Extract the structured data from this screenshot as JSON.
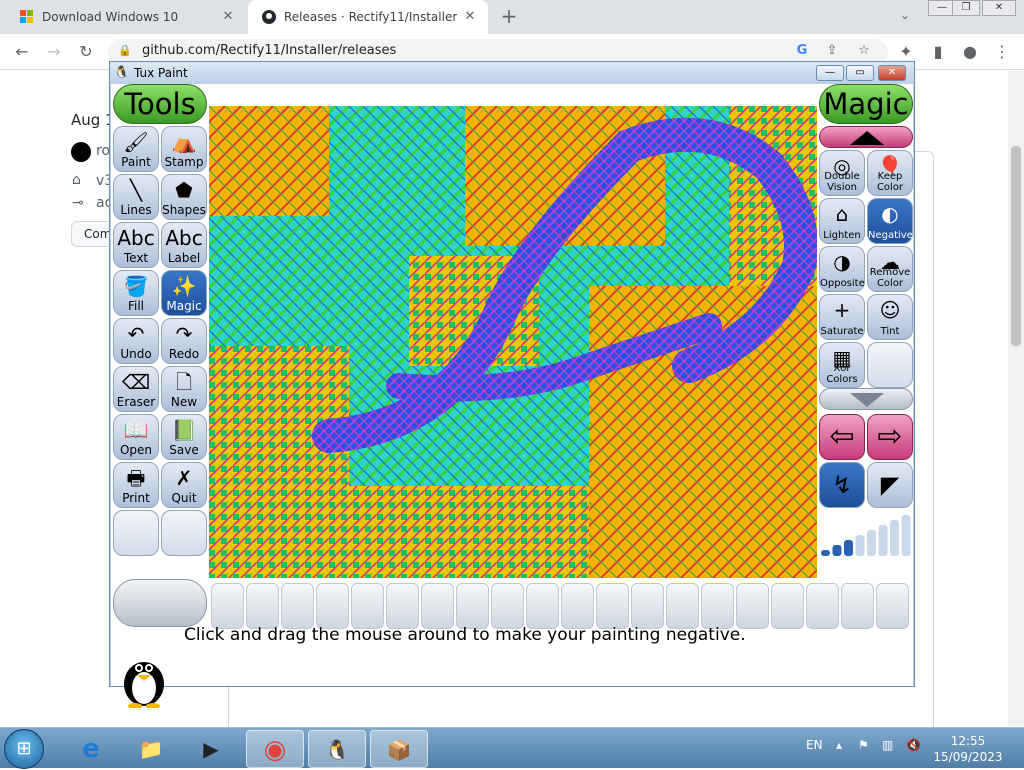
{
  "browser": {
    "tabs": [
      {
        "label": "Download Windows 10",
        "active": false,
        "icon": "windows-logo-icon"
      },
      {
        "label": "Releases · Rectify11/Installer",
        "active": true,
        "icon": "github-icon"
      }
    ],
    "url": "github.com/Rectify11/Installer/releases",
    "window_controls": {
      "minimize": "—",
      "restore": "❐",
      "close": "✕"
    }
  },
  "github_page": {
    "date_fragment": "Aug 1",
    "user_fragment": "ro",
    "tag_fragment": "v3",
    "commit_fragment": "ac",
    "compare_fragment": "Com"
  },
  "tuxpaint": {
    "title": "Tux Paint",
    "tools_header": "Tools",
    "magic_header": "Magic",
    "tools": [
      {
        "label": "Paint",
        "icon": "paintbrush-icon",
        "glyph": "🖌"
      },
      {
        "label": "Stamp",
        "icon": "stamp-icon",
        "glyph": "⛺"
      },
      {
        "label": "Lines",
        "icon": "lines-icon",
        "glyph": "╲"
      },
      {
        "label": "Shapes",
        "icon": "pentagon-icon",
        "glyph": "⬟"
      },
      {
        "label": "Text",
        "icon": "text-abc-icon",
        "glyph": "Abc"
      },
      {
        "label": "Label",
        "icon": "label-abc-icon",
        "glyph": "Abc"
      },
      {
        "label": "Fill",
        "icon": "paint-bucket-icon",
        "glyph": "🪣"
      },
      {
        "label": "Magic",
        "icon": "magic-wand-icon",
        "glyph": "✨",
        "selected": true
      },
      {
        "label": "Undo",
        "icon": "undo-hand-icon",
        "glyph": "↶"
      },
      {
        "label": "Redo",
        "icon": "redo-hand-icon",
        "glyph": "↷"
      },
      {
        "label": "Eraser",
        "icon": "eraser-icon",
        "glyph": "⌫"
      },
      {
        "label": "New",
        "icon": "new-page-icon",
        "glyph": "🗋"
      },
      {
        "label": "Open",
        "icon": "open-book-icon",
        "glyph": "📖"
      },
      {
        "label": "Save",
        "icon": "save-book-icon",
        "glyph": "📗"
      },
      {
        "label": "Print",
        "icon": "printer-icon",
        "glyph": "🖶"
      },
      {
        "label": "Quit",
        "icon": "quit-x-icon",
        "glyph": "✗"
      }
    ],
    "magic_items": [
      {
        "label": "Double Vision",
        "icon": "double-vision-icon",
        "glyph": "◎"
      },
      {
        "label": "Keep Color",
        "icon": "keep-color-icon",
        "glyph": "🎈"
      },
      {
        "label": "Lighten",
        "icon": "lighten-house-icon",
        "glyph": "⌂"
      },
      {
        "label": "Negative",
        "icon": "negative-icon",
        "glyph": "◐",
        "selected": true
      },
      {
        "label": "Opposite",
        "icon": "opposite-icon",
        "glyph": "◑"
      },
      {
        "label": "Remove Color",
        "icon": "remove-color-icon",
        "glyph": "☁"
      },
      {
        "label": "Saturate",
        "icon": "saturate-icon",
        "glyph": "+"
      },
      {
        "label": "Tint",
        "icon": "tint-faces-icon",
        "glyph": "☺"
      },
      {
        "label": "Xor Colors",
        "icon": "xor-colors-icon",
        "glyph": "▦"
      },
      {
        "label": "",
        "icon": "empty-slot-icon",
        "glyph": ""
      }
    ],
    "status_text": "Click and drag the mouse around to make your painting negative."
  },
  "taskbar": {
    "language": "EN",
    "time": "12:55",
    "date": "15/09/2023",
    "apps": [
      {
        "name": "internet-explorer-icon",
        "glyph": "e"
      },
      {
        "name": "file-explorer-icon",
        "glyph": "📁"
      },
      {
        "name": "media-player-icon",
        "glyph": "▶"
      },
      {
        "name": "chrome-icon",
        "glyph": "◉"
      },
      {
        "name": "tuxpaint-taskbar-icon",
        "glyph": "🐧"
      },
      {
        "name": "installer-package-icon",
        "glyph": "📦"
      }
    ]
  },
  "colors": {
    "tools_header_green": "#5cbf3a",
    "selected_blue": "#2a62b0",
    "scroll_pink": "#d9588f"
  }
}
